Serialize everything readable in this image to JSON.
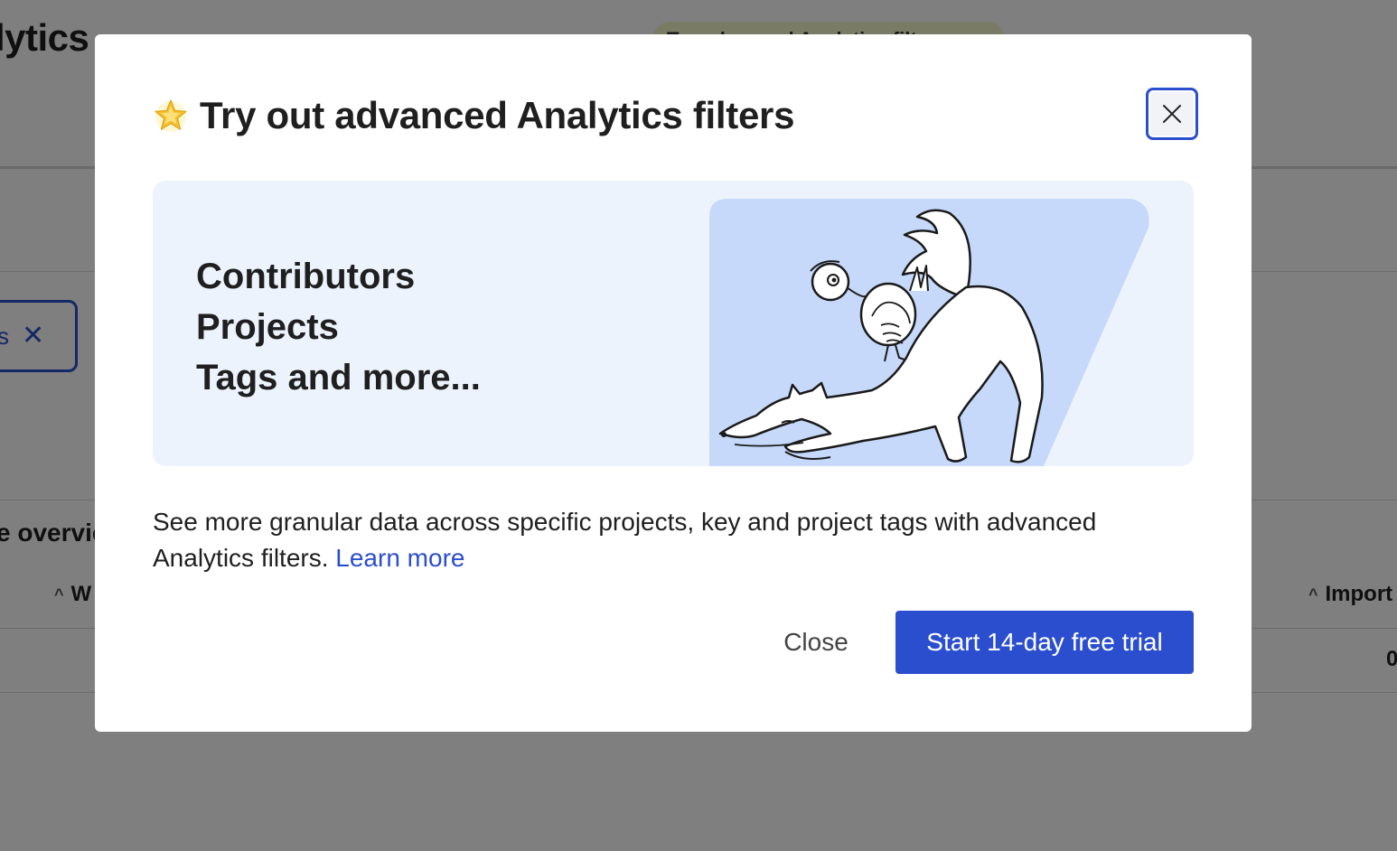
{
  "background": {
    "page_title": "lytics",
    "promo_pill": "Try advanced Analytics filters",
    "filter_chip_text": "s",
    "overview_label": "e overview",
    "column_w": "W",
    "column_import": "Import",
    "cell_value": "0"
  },
  "modal": {
    "title": "Try out advanced Analytics filters",
    "title_icon": "star-icon",
    "close_icon": "close-icon",
    "features": [
      "Contributors",
      "Projects",
      "Tags and more..."
    ],
    "illustration": "fox-and-bird-illustration",
    "description": "See more granular data across specific projects, key and project tags with advanced Analytics filters.",
    "learn_more": "Learn more",
    "close_label": "Close",
    "trial_label": "Start 14-day free trial"
  },
  "colors": {
    "accent": "#2b4ecf",
    "banner_bg": "#edf3fd",
    "illustration_bg": "#c6d9fa",
    "overlay": "rgba(0,0,0,0.5)"
  }
}
